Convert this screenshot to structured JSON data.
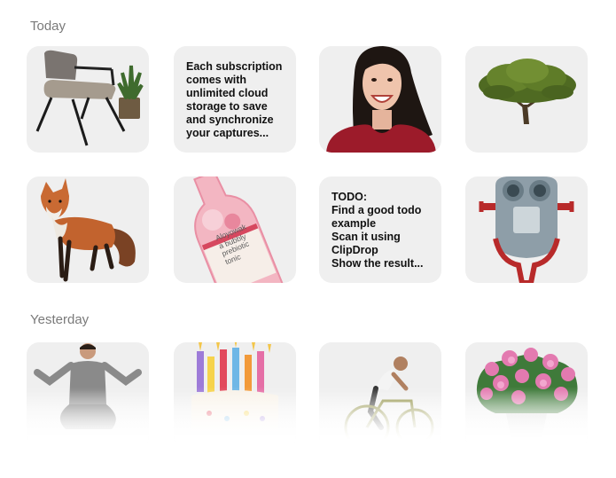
{
  "sections": {
    "today": {
      "title": "Today"
    },
    "yesterday": {
      "title": "Yesterday"
    }
  },
  "captures": {
    "subscription_note": "Each subscription\ncomes with\nunlimited cloud\nstorage to save\nand synchronize\nyour captures...",
    "todo_note": "TODO:\nFind a good todo\nexample\nScan it using\nClipDrop\nShow the result..."
  },
  "bottle_label": {
    "line1": "Aloyowak",
    "line2": "a bubbly",
    "line3": "prebiotic",
    "line4": "tonic"
  },
  "colors": {
    "card_bg": "#efefef",
    "section_title": "#7a7a7a"
  }
}
